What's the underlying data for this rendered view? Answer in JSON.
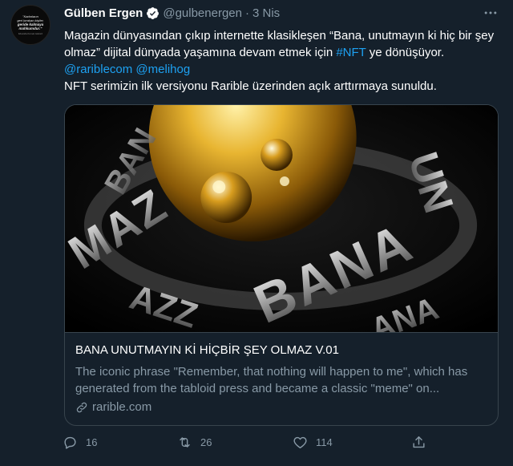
{
  "author": {
    "name": "Gülben Ergen",
    "handle": "@gulbenergen",
    "separator": "·",
    "date": "3 Nis",
    "avatar_lines": [
      "\"Kadınların",
      "geri bırakan kişiler,",
      "geride kalmaya",
      "mahkumdur.\"",
      "Mustafa Kemal Atatürk"
    ]
  },
  "tweet": {
    "line1": "Magazin dünyasından çıkıp internette klasikleşen “Bana, unutmayın ki hiç bir şey olmaz” dijital dünyada yaşamına devam etmek için ",
    "hashtag": "#NFT",
    "line1_end": " ye dönüşüyor.",
    "mention1": "@rariblecom",
    "mention2": "@melihog",
    "line3": "NFT serimizin ilk versiyonu Rarible üzerinden açık arttırmaya sunuldu."
  },
  "card": {
    "image_text": "BANA UNUTMAZ",
    "title": "BANA UNUTMAYIN Kİ HİÇBİR ŞEY OLMAZ V.01",
    "description": "The iconic phrase \"Remember, that nothing will happen to me\", which has generated from the tabloid press and became a classic \"meme\" on...",
    "domain": "rarible.com"
  },
  "actions": {
    "replies": "16",
    "retweets": "26",
    "likes": "114"
  },
  "colors": {
    "background": "#15202b",
    "accent": "#1da1f2",
    "muted": "#8899a6",
    "border": "#38444d"
  },
  "icons": [
    "verified-badge-icon",
    "more-icon",
    "link-icon",
    "reply-icon",
    "retweet-icon",
    "like-icon",
    "share-icon"
  ]
}
